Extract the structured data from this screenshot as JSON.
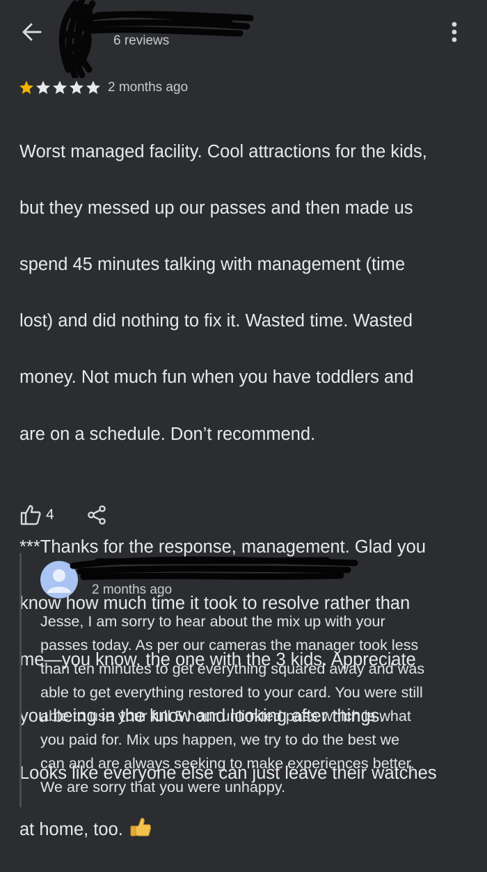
{
  "header": {
    "reviewer_meta": "6 reviews",
    "back_icon": "arrow-left-icon",
    "more_icon": "more-vert-icon"
  },
  "review": {
    "rating": 1,
    "max_rating": 5,
    "time": "2 months ago",
    "paragraph1": [
      "Worst managed facility. Cool attractions for the kids,",
      "but they messed up our passes and then made us",
      "spend 45 minutes talking with management (time",
      "lost) and did nothing to fix it. Wasted time. Wasted",
      "money. Not much fun when you have toddlers and",
      "are on a schedule. Don’t recommend."
    ],
    "paragraph2": [
      "***Thanks for the response, management. Glad you",
      "know how much time it took to resolve rather than",
      "me—you know, the one with the 3 kids. Appreciate",
      "you being in the know and looking after things.",
      "Looks like everyone else can just leave their watches"
    ],
    "last_line": "at home, too.",
    "emoji": "thumbs-up-emoji",
    "likes": "4"
  },
  "owner_reply": {
    "time": "2 months ago",
    "lines": [
      "Jesse, I am sorry to hear about the mix up with your",
      "passes today. As per our cameras the manager took less",
      "than ten minutes to get everything squared away and was",
      "able to get everything restored to your card. You were still",
      "able to use your full 5 hour unlimited pass which is what",
      "you paid for. Mix ups happen, we try to do the best we",
      "can and are always seeking to make experiences better.",
      "We are sorry that you were unhappy."
    ]
  },
  "colors": {
    "background": "#2b2d30",
    "star_filled": "#f4b400",
    "star_empty": "#e8e9eb",
    "avatar": "#a9c4f2"
  }
}
